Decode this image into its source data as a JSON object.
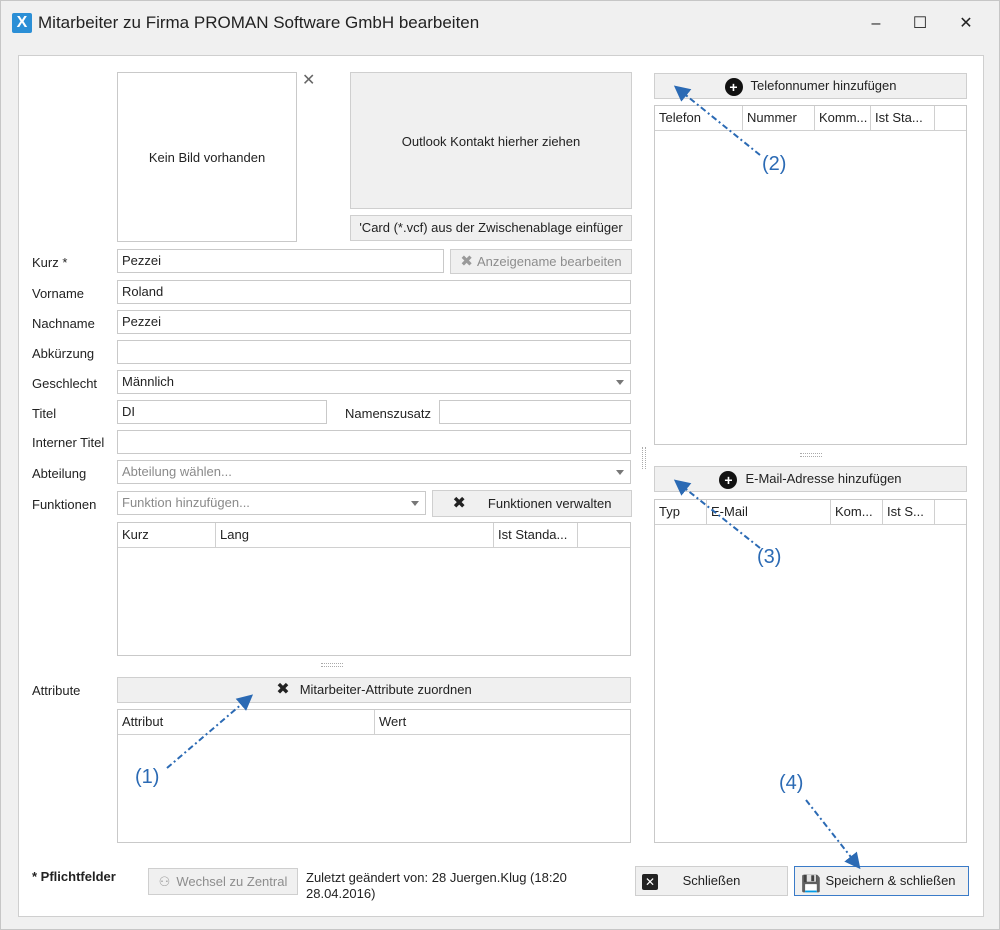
{
  "window": {
    "icon_glyph": "X",
    "title": "Mitarbeiter zu Firma PROMAN Software GmbH bearbeiten",
    "minimize_glyph": "‒",
    "maximize_glyph": "☐",
    "close_glyph": "✕"
  },
  "photo": {
    "empty_text": "Kein Bild vorhanden",
    "remove_glyph": "✕"
  },
  "outlook": {
    "drop_text": "Outlook Kontakt hierher ziehen",
    "vcard_button": "'Card (*.vcf) aus der Zwischenablage einfüger"
  },
  "form": {
    "kurz_label": "Kurz *",
    "kurz_value": "Pezzei",
    "display_name_button": "Anzeigename bearbeiten",
    "vorname_label": "Vorname",
    "vorname_value": "Roland",
    "nachname_label": "Nachname",
    "nachname_value": "Pezzei",
    "abkuerzung_label": "Abkürzung",
    "abkuerzung_value": "",
    "geschlecht_label": "Geschlecht",
    "geschlecht_value": "Männlich",
    "titel_label": "Titel",
    "titel_value": "DI",
    "namenszusatz_label": "Namenszusatz",
    "namenszusatz_value": "",
    "interner_titel_label": "Interner Titel",
    "interner_titel_value": "",
    "abteilung_label": "Abteilung",
    "abteilung_placeholder": "Abteilung wählen...",
    "funktionen_label": "Funktionen",
    "funktionen_placeholder": "Funktion hinzufügen...",
    "funktionen_manage_button": "Funktionen verwalten",
    "attribute_label": "Attribute",
    "attribute_assign_button": "Mitarbeiter-Attribute zuordnen"
  },
  "funktionen_grid": {
    "columns": [
      "Kurz",
      "Lang",
      "Ist Standa..."
    ]
  },
  "attribute_grid": {
    "columns": [
      "Attribut",
      "Wert"
    ]
  },
  "phone": {
    "add_button": "Telefonnumer hinzufügen",
    "columns": [
      "Telefon",
      "Nummer",
      "Komm...",
      "Ist Sta..."
    ]
  },
  "email": {
    "add_button": "E-Mail-Adresse hinzufügen",
    "columns": [
      "Typ",
      "E-Mail",
      "Kom...",
      "Ist S..."
    ]
  },
  "footer": {
    "required_note": "* Pflichtfelder",
    "switch_button": "Wechsel zu Zentral",
    "last_changed_line1": "Zuletzt geändert von: 28 Juergen.Klug (18:20",
    "last_changed_line2": "28.04.2016)",
    "close_button": "Schließen",
    "save_close_button": "Speichern & schließen"
  },
  "annotations": [
    "(1)",
    "(2)",
    "(3)",
    "(4)"
  ],
  "colors": {
    "annotation": "#2b6ab4",
    "accent": "#2b8fd6"
  }
}
